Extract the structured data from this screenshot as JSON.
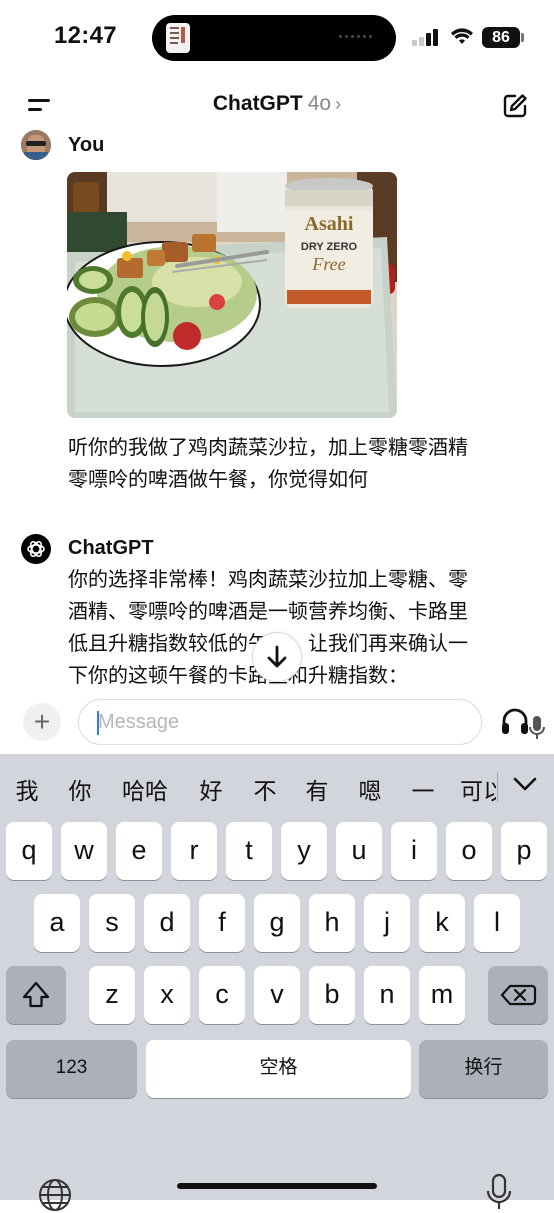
{
  "status": {
    "time": "12:47",
    "battery": "86"
  },
  "header": {
    "app_name": "ChatGPT",
    "model": "4o",
    "chevron": "›",
    "menu_icon": "menu-icon",
    "new_chat_icon": "new-chat-icon"
  },
  "chat": {
    "user_name": "You",
    "user_message_lines": [
      "听你的我做了鸡肉蔬菜沙拉，加上零糖零酒精",
      "零嘌呤的啤酒做午餐，你觉得如何"
    ],
    "photo": {
      "can_text": [
        "DRY ZERO",
        "Free",
        "Asahi"
      ]
    },
    "assistant_name": "ChatGPT",
    "assistant_message_lines": [
      "你的选择非常棒！鸡肉蔬菜沙拉加上零糖、零",
      "酒精、零嘌呤的啤酒是一顿营养均衡、卡路里",
      "低且升糖指数较低的午餐。让我们再来确认一",
      "下你的这顿午餐的卡路里和升糖指数："
    ]
  },
  "composer": {
    "plus_label": "+",
    "placeholder": "Message"
  },
  "keyboard": {
    "suggestions": [
      "我",
      "你",
      "哈哈",
      "好",
      "不",
      "有",
      "嗯",
      "一",
      "可以"
    ],
    "row1": [
      "q",
      "w",
      "e",
      "r",
      "t",
      "y",
      "u",
      "i",
      "o",
      "p"
    ],
    "row2": [
      "a",
      "s",
      "d",
      "f",
      "g",
      "h",
      "j",
      "k",
      "l"
    ],
    "row3": [
      "z",
      "x",
      "c",
      "v",
      "b",
      "n",
      "m"
    ],
    "numbers_label": "123",
    "space_label": "空格",
    "return_label": "换行"
  },
  "colors": {
    "accent": "#3478f6",
    "keyboard_bg": "#d2d5dc"
  }
}
